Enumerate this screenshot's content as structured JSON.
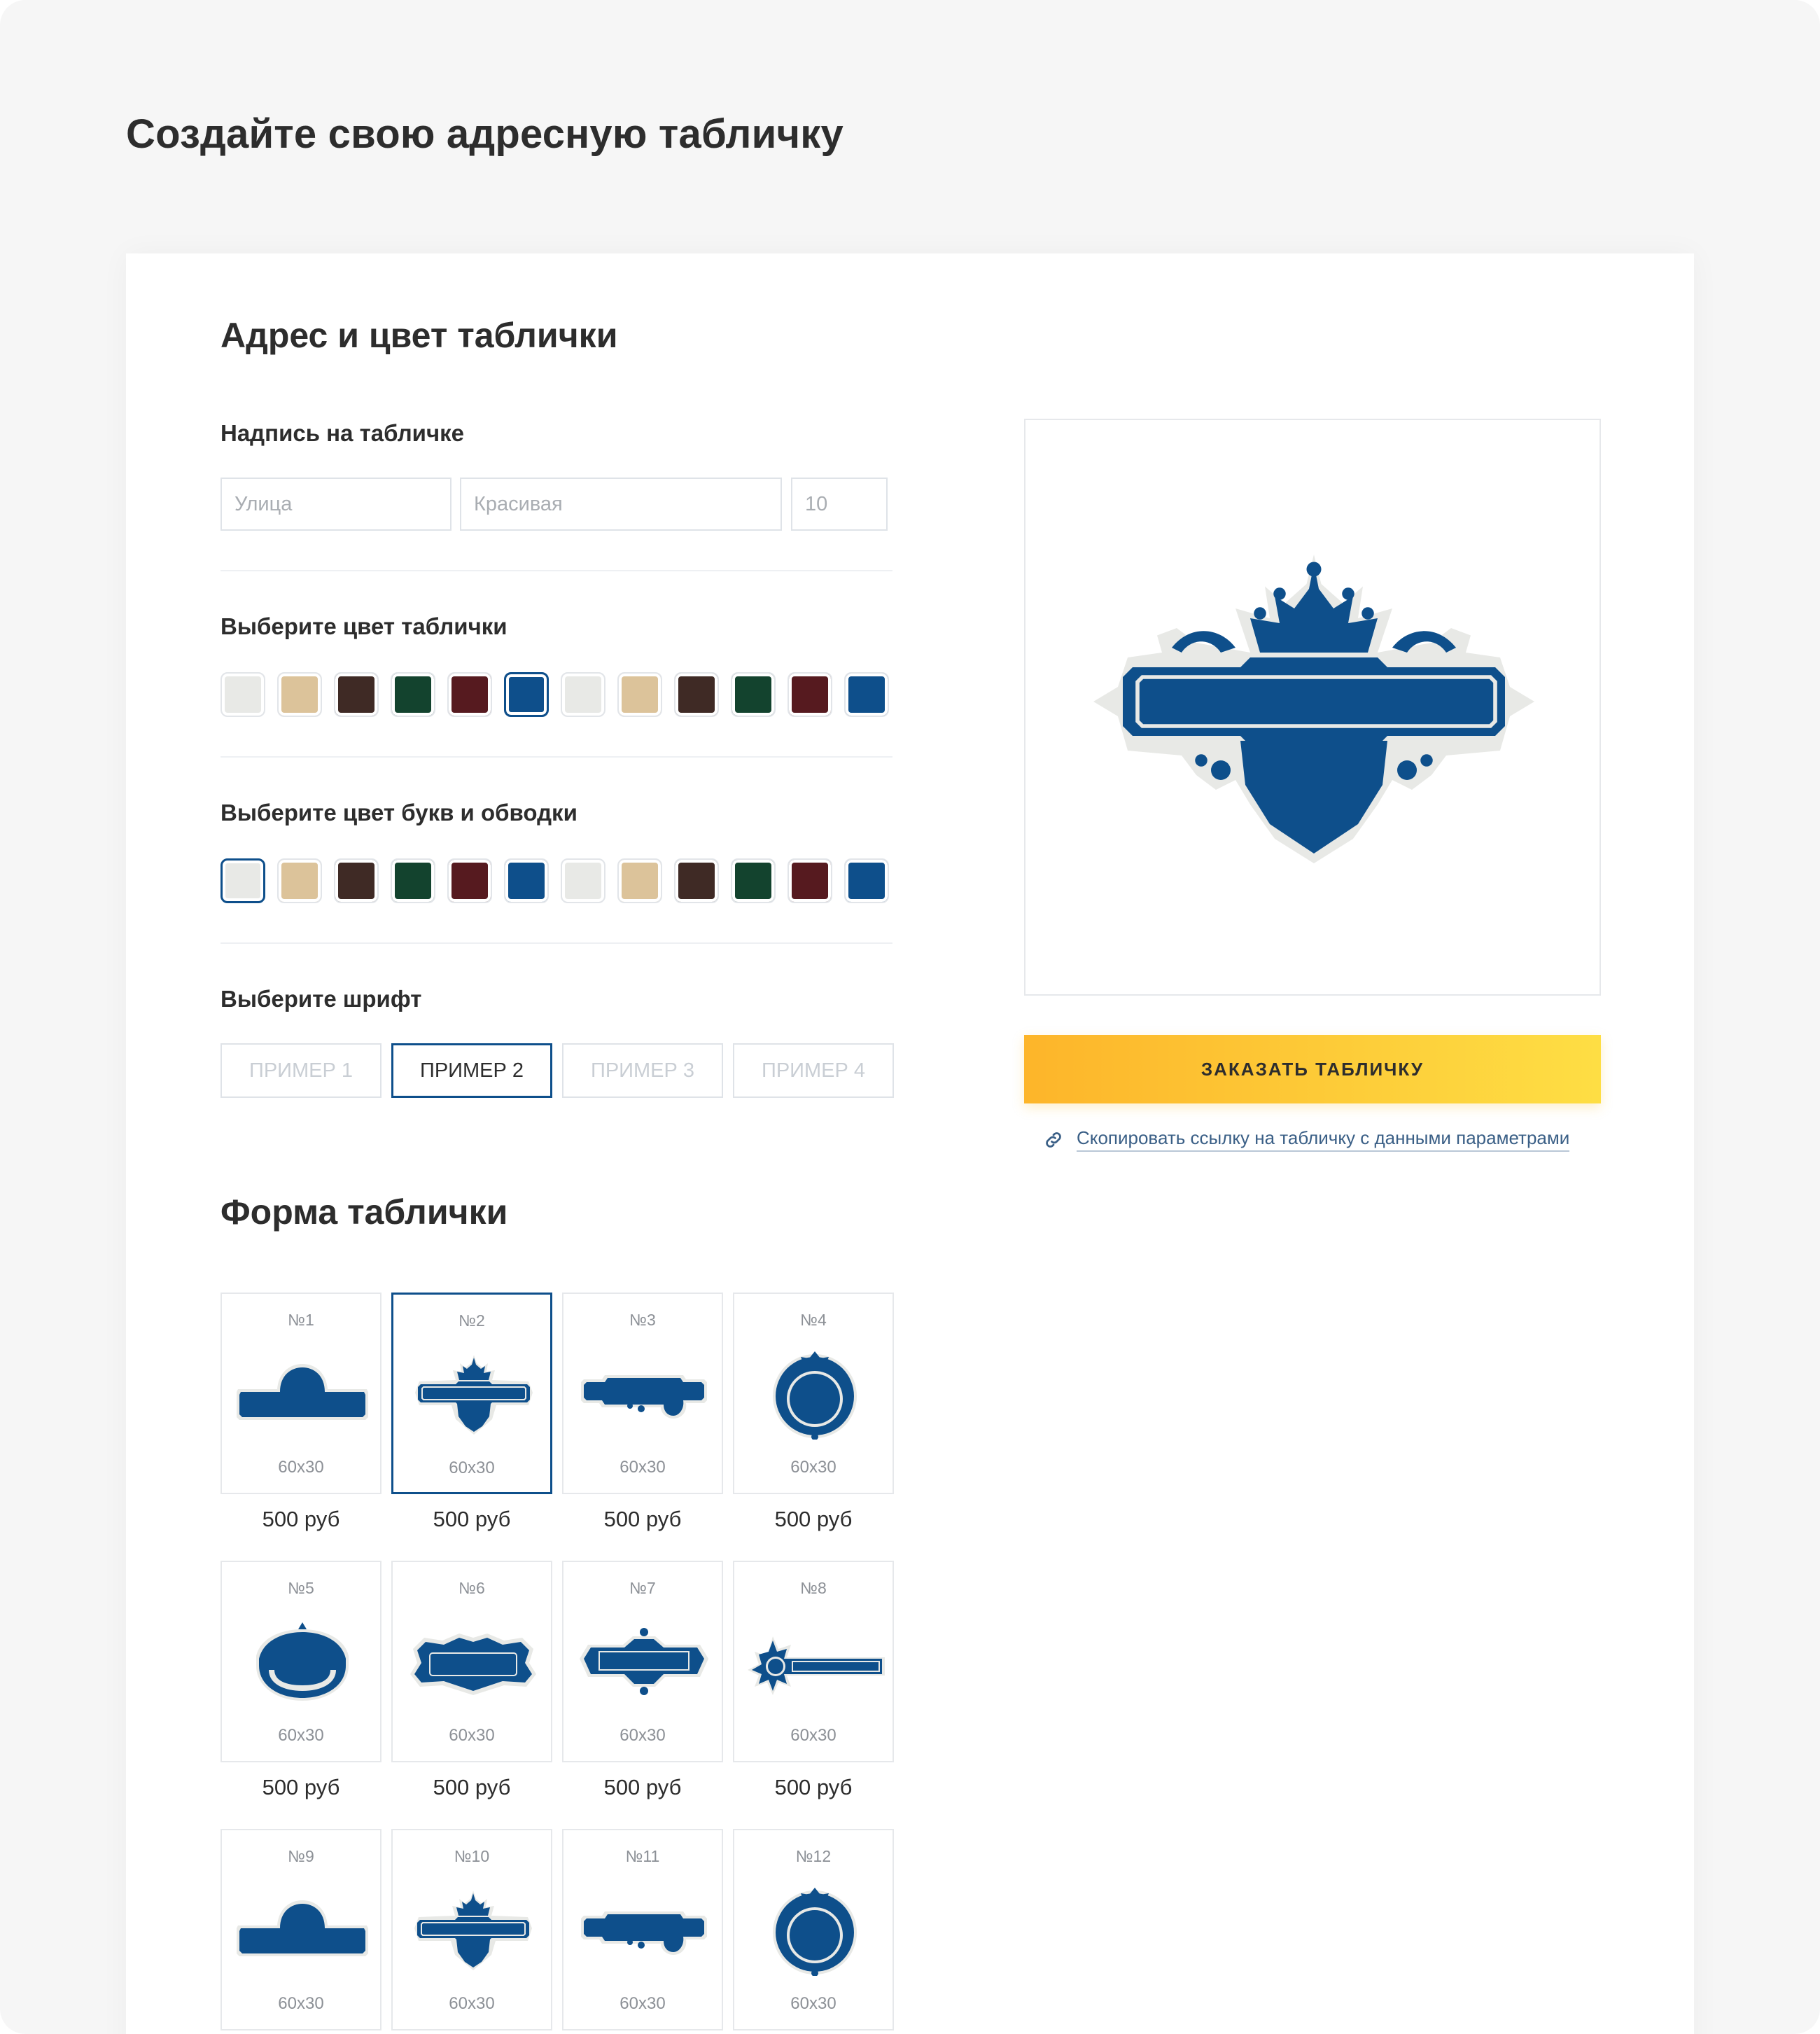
{
  "page": {
    "title": "Создайте свою адресную табличку"
  },
  "address_section": {
    "title": "Адрес и цвет таблички",
    "inscription_label": "Надпись на табличке",
    "inputs": [
      {
        "placeholder": "Улица",
        "value": ""
      },
      {
        "placeholder": "Красивая",
        "value": ""
      },
      {
        "placeholder": "10",
        "value": ""
      }
    ],
    "plate_color_label": "Выберите цвет таблички",
    "letter_color_label": "Выберите цвет букв и обводки",
    "font_label": "Выберите шрифт"
  },
  "palette": [
    "#e8e9e6",
    "#dcc39a",
    "#3f2a25",
    "#13432e",
    "#561a1f",
    "#0e4f8b",
    "#e8e9e6",
    "#dcc39a",
    "#3f2a25",
    "#13432e",
    "#561a1f",
    "#0e4f8b"
  ],
  "plate_color_selected_index": 5,
  "letter_color_selected_index": 0,
  "fonts": [
    {
      "label": "ПРИМЕР 1",
      "active": false
    },
    {
      "label": "ПРИМЕР 2",
      "active": true
    },
    {
      "label": "ПРИМЕР 3",
      "active": false
    },
    {
      "label": "ПРИМЕР 4",
      "active": false
    }
  ],
  "preview": {
    "plate_color": "#0e4f8b",
    "outline_color": "#e8e9e6",
    "icon": "crown-shield-plate"
  },
  "order_button": {
    "label": "ЗАКАЗАТЬ ТАБЛИЧКУ"
  },
  "copy_link": {
    "label": "Скопировать ссылку на табличку с данными параметрами",
    "icon": "link-icon"
  },
  "shape_section": {
    "title": "Форма таблички",
    "selected_index": 1,
    "shapes": [
      {
        "number": "№1",
        "size": "60х30",
        "price": "500 руб",
        "icon": "arch-plate"
      },
      {
        "number": "№2",
        "size": "60х30",
        "price": "500 руб",
        "icon": "crown-shield-plate"
      },
      {
        "number": "№3",
        "size": "60х30",
        "price": "500 руб",
        "icon": "notched-scroll-plate"
      },
      {
        "number": "№4",
        "size": "60х30",
        "price": "500 руб",
        "icon": "round-ornate-plate"
      },
      {
        "number": "№5",
        "size": "60х30",
        "price": "500 руб",
        "icon": "half-round-ornate-plate"
      },
      {
        "number": "№6",
        "size": "60х30",
        "price": "500 руб",
        "icon": "baroque-frame-plate"
      },
      {
        "number": "№7",
        "size": "60х30",
        "price": "500 руб",
        "icon": "scroll-frame-plate"
      },
      {
        "number": "№8",
        "size": "60х30",
        "price": "500 руб",
        "icon": "star-bar-plate"
      },
      {
        "number": "№9",
        "size": "60х30",
        "price": "",
        "icon": "arch-plate"
      },
      {
        "number": "№10",
        "size": "60х30",
        "price": "",
        "icon": "crown-shield-plate"
      },
      {
        "number": "№11",
        "size": "60х30",
        "price": "",
        "icon": "notched-scroll-plate"
      },
      {
        "number": "№12",
        "size": "60х30",
        "price": "",
        "icon": "round-ornate-plate"
      }
    ]
  }
}
